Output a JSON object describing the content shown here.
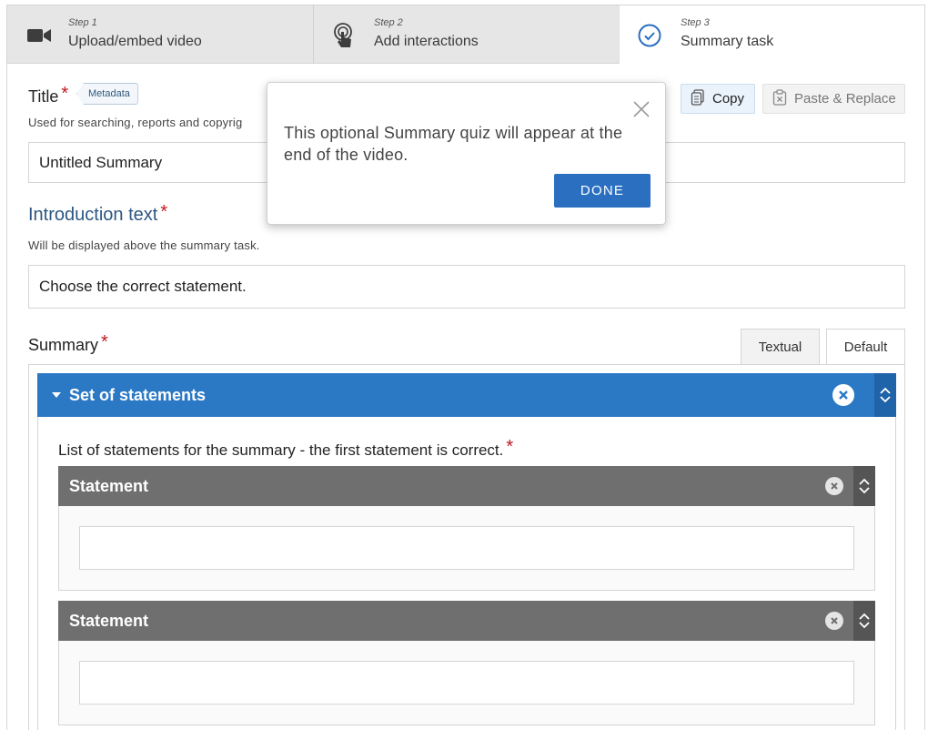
{
  "steps": [
    {
      "num": "Step 1",
      "title": "Upload/embed video",
      "icon": "video-camera-icon"
    },
    {
      "num": "Step 2",
      "title": "Add interactions",
      "icon": "touch-icon"
    },
    {
      "num": "Step 3",
      "title": "Summary task",
      "icon": "check-circle-icon",
      "active": true
    }
  ],
  "title_field": {
    "label": "Title",
    "required": "*",
    "metadata": "Metadata",
    "description": "Used for searching, reports and copyrig",
    "value": "Untitled Summary"
  },
  "toolbar": {
    "copy": "Copy",
    "paste_replace": "Paste & Replace"
  },
  "intro_field": {
    "label": "Introduction text",
    "required": "*",
    "description": "Will be displayed above the summary task.",
    "value": "Choose the correct statement."
  },
  "summary": {
    "label": "Summary",
    "required": "*",
    "tabs": [
      "Textual",
      "Default"
    ],
    "active_tab": "Default",
    "set_title": "Set of statements",
    "list_label": "List of statements for the summary - the first statement is correct.",
    "list_required": "*",
    "statements": [
      {
        "title": "Statement",
        "value": ""
      },
      {
        "title": "Statement",
        "value": ""
      }
    ]
  },
  "popup": {
    "text": "This optional Summary quiz will appear at the end of the video.",
    "done": "DONE"
  },
  "colors": {
    "accent": "#2b78c5",
    "required": "#c0171d",
    "statement_header": "#6f6f6f",
    "done_button": "#2b6fc1"
  }
}
